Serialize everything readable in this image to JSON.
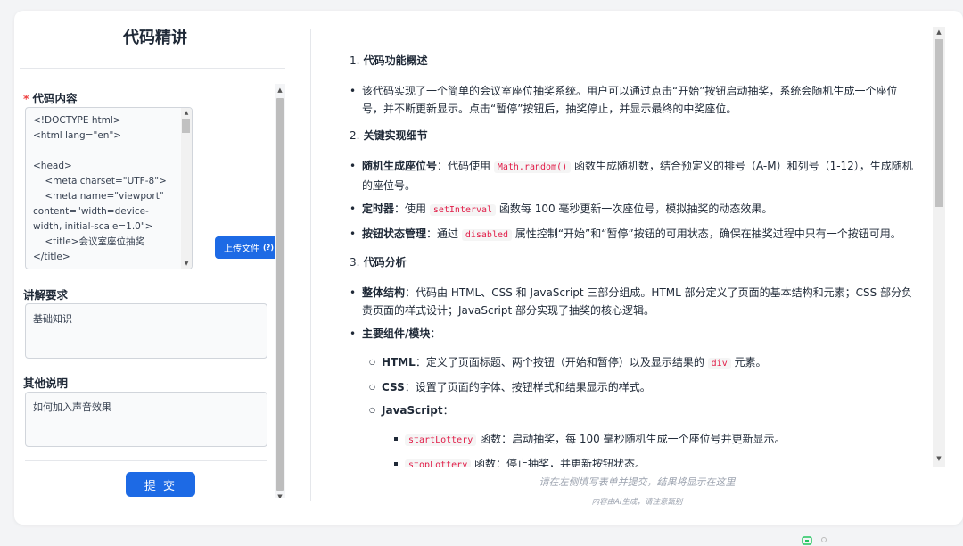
{
  "left_panel": {
    "title": "代码精讲",
    "code_label": "代码内容",
    "code_required_mark": "*",
    "code_content": "<!DOCTYPE html>\n<html lang=\"en\">\n\n<head>\n    <meta charset=\"UTF-8\">\n    <meta name=\"viewport\" content=\"width=device-width, initial-scale=1.0\">\n    <title>会议室座位抽奖\n</title>",
    "upload_button": "上传文件",
    "upload_hint": "(?)",
    "requirement_label": "讲解要求",
    "requirement_value": "基础知识",
    "other_label": "其他说明",
    "other_value": "如何加入声音效果",
    "submit_button": "提 交"
  },
  "right_panel": {
    "sections": [
      {
        "num": "1.",
        "title": "代码功能概述"
      },
      {
        "num": "2.",
        "title": "关键实现细节"
      },
      {
        "num": "3.",
        "title": "代码分析"
      }
    ],
    "overview_text": "该代码实现了一个简单的会议室座位抽奖系统。用户可以通过点击“开始”按钮启动抽奖，系统会随机生成一个座位号，并不断更新显示。点击“暂停”按钮后，抽奖停止，并显示最终的中奖座位。",
    "detail1_bold": "随机生成座位号",
    "detail1_pre": "：代码使用 ",
    "detail1_code": "Math.random()",
    "detail1_post": " 函数生成随机数，结合预定义的排号（A-M）和列号（1-12），生成随机的座位号。",
    "detail2_bold": "定时器",
    "detail2_pre": "：使用 ",
    "detail2_code": "setInterval",
    "detail2_post": " 函数每 100 毫秒更新一次座位号，模拟抽奖的动态效果。",
    "detail3_bold": "按钮状态管理",
    "detail3_pre": "：通过 ",
    "detail3_code": "disabled",
    "detail3_post": " 属性控制“开始”和“暂停”按钮的可用状态，确保在抽奖过程中只有一个按钮可用。",
    "analysis1_bold": "整体结构",
    "analysis1_text": "：代码由 HTML、CSS 和 JavaScript 三部分组成。HTML 部分定义了页面的基本结构和元素；CSS 部分负责页面的样式设计；JavaScript 部分实现了抽奖的核心逻辑。",
    "analysis2_bold": "主要组件/模块",
    "analysis2_text": "：",
    "html_bold": "HTML",
    "html_pre": "：定义了页面标题、两个按钮（开始和暂停）以及显示结果的 ",
    "html_code": "div",
    "html_post": " 元素。",
    "css_bold": "CSS",
    "css_text": "：设置了页面的字体、按钮样式和结果显示的样式。",
    "js_bold": "JavaScript",
    "js_text": "：",
    "fn1_code": "startLottery",
    "fn1_text": " 函数：启动抽奖，每 100 毫秒随机生成一个座位号并更新显示。",
    "fn2_code": "stopLottery",
    "fn2_text": " 函数：停止抽奖，并更新按钮状态。"
  },
  "footer": {
    "hint": "请在左侧填写表单并提交，结果将显示在这里",
    "disclaimer": "内容由AI生成，请注意甄别"
  },
  "colors": {
    "accent": "#1d6ae5",
    "required": "#ef4444",
    "inline_code": "#e11d48"
  }
}
